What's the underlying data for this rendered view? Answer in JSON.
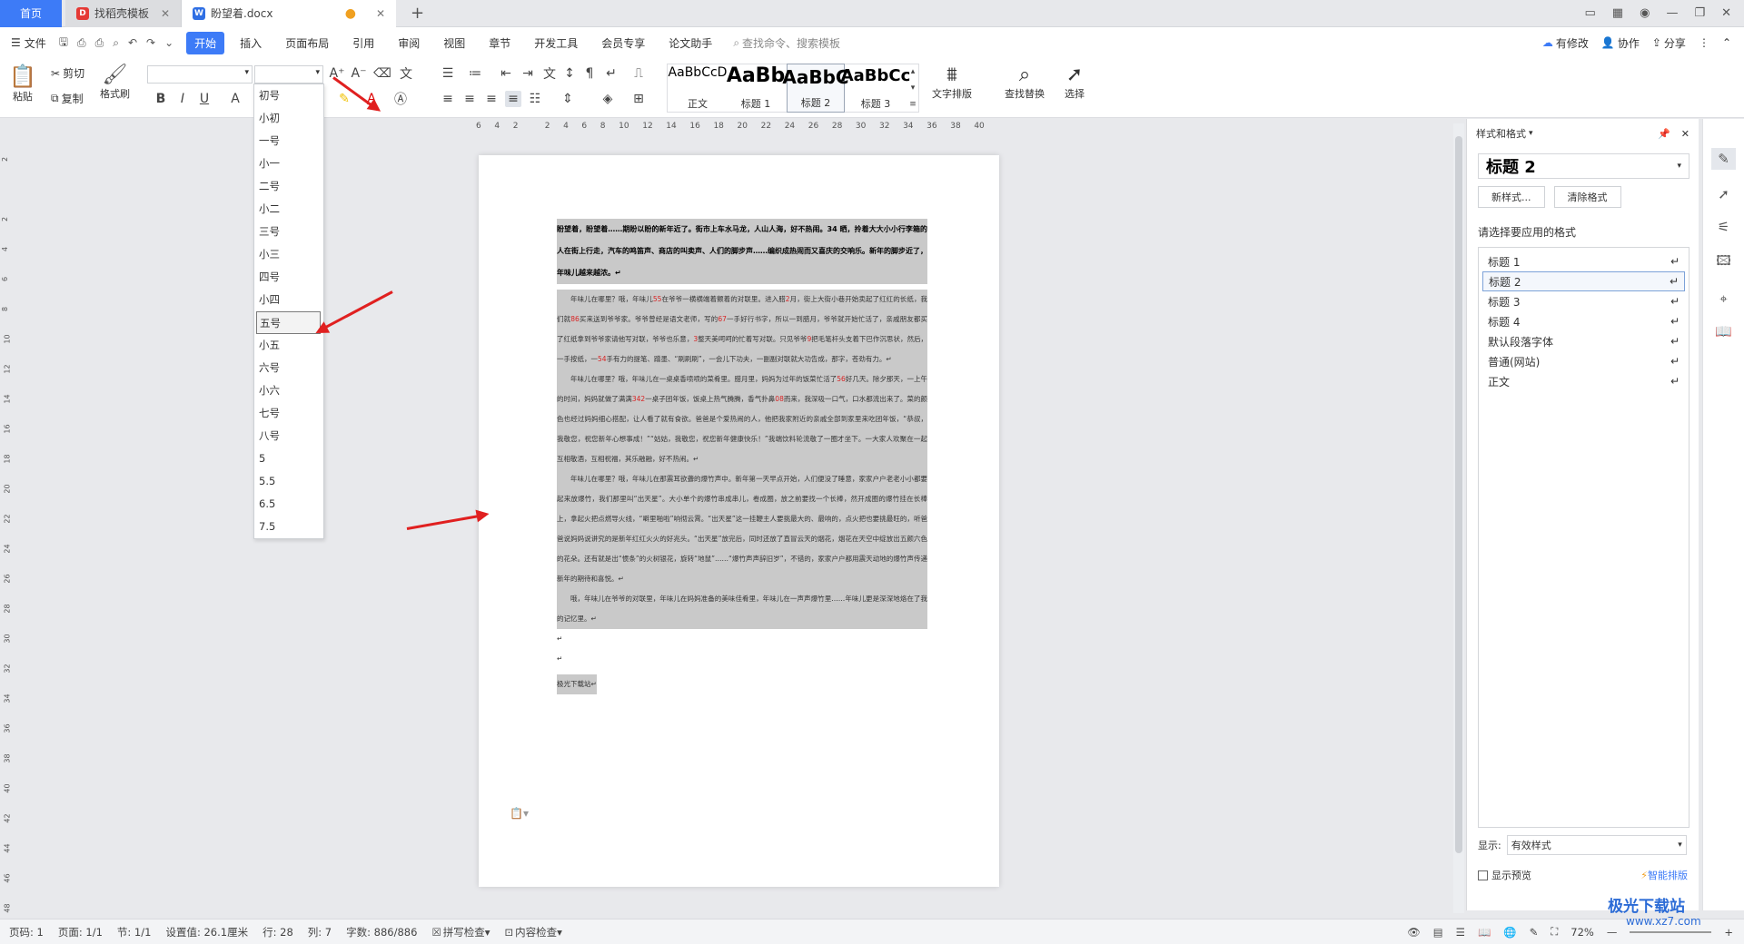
{
  "tabs": {
    "home": "首页",
    "template": "找稻壳模板",
    "doc": "盼望着.docx"
  },
  "menu": {
    "file": "文件",
    "items": [
      "开始",
      "插入",
      "页面布局",
      "引用",
      "审阅",
      "视图",
      "章节",
      "开发工具",
      "会员专享",
      "论文助手"
    ],
    "search": "查找命令、搜索模板",
    "right": [
      "有修改",
      "协作",
      "分享"
    ]
  },
  "ribbon": {
    "paste": "粘贴",
    "cut": "剪切",
    "copy": "复制",
    "format_painter": "格式刷",
    "styles": [
      {
        "preview": "AaBbCcD",
        "name": "正文"
      },
      {
        "preview": "AaBb",
        "name": "标题 1"
      },
      {
        "preview": "AaBbC",
        "name": "标题 2"
      },
      {
        "preview": "AaBbCc",
        "name": "标题 3"
      }
    ],
    "text_layout": "文字排版",
    "find_replace": "查找替换",
    "select": "选择"
  },
  "font_size_dropdown": {
    "options": [
      "初号",
      "小初",
      "一号",
      "小一",
      "二号",
      "小二",
      "三号",
      "小三",
      "四号",
      "小四",
      "五号",
      "小五",
      "六号",
      "小六",
      "七号",
      "八号",
      "5",
      "5.5",
      "6.5",
      "7.5"
    ],
    "selected": "五号"
  },
  "ruler_top": [
    "6",
    "4",
    "2",
    "",
    "2",
    "4",
    "6",
    "8",
    "10",
    "12",
    "14",
    "16",
    "18",
    "20",
    "22",
    "24",
    "26",
    "28",
    "30",
    "32",
    "34",
    "36",
    "38",
    "40"
  ],
  "ruler_left": [
    "2",
    "",
    "2",
    "4",
    "6",
    "8",
    "10",
    "12",
    "14",
    "16",
    "18",
    "20",
    "22",
    "24",
    "26",
    "28",
    "30",
    "32",
    "34",
    "36",
    "38",
    "40",
    "42",
    "44",
    "46",
    "48"
  ],
  "document": {
    "para1": "盼望着，盼望着……期盼以盼的新年近了。街市上车水马龙，人山人海，好不热闹。34 晒，拎着大大小小行李箱的人在街上行走，汽车的鸣笛声、商店的叫卖声、人们的脚步声……编织成热闹而又喜庆的交响乐。新年的脚步近了，年味儿越来越浓。↵",
    "para2_parts": [
      "年味儿在哪里？哦，年味儿",
      "55",
      "在爷爷一横横端着颤着的对联里。进入腊",
      "2",
      "月，街上大街小巷开始卖起了红红的长纸，我们就",
      "86",
      "买来送到爷爷家。爷爷曾经是语文老师，写的",
      "67",
      "一手好行书字，所以一到腊月，爷爷就开始忙活了，亲戚朋友都买了红纸拿到爷爷家请他写对联，爷爷也乐意，",
      "3",
      "整天美呵呵的忙着写对联。只见爷爷",
      "9",
      "把毛笔杆头支着下巴作沉思状，然后，一手按纸，一",
      "54",
      "手有力的提笔、蹭墨、“刷刷刷”，一会儿下功夫，一副副对联就大功告成，那字，苍劲有力。↵"
    ],
    "para3_parts": [
      "年味儿在哪里？哦，年味儿在一桌桌香喷喷的菜肴里。腊月里，妈妈为过年的饭菜忙活了",
      "56",
      "好几天。除夕那天，一上午的时间，妈妈就做了满满",
      "342",
      "一桌子团年饭，饭桌上热气腾腾，香气扑鼻",
      "08",
      "而来，我深吸一口气，口水都流出来了。菜的颜色也经过妈妈细心搭配，让人看了就有食欲。爸爸是个爱热闹的人，他把我家附近的亲戚全部到家里来吃团年饭，“恭叔，我敬您，祝您新年心想事成！”“姑姑，我敬您，祝您新年健康快乐！”我端饮料轮流敬了一圈才坐下。一大家人欢聚在一起互相敬酒，互相祝福，其乐融融，好不热闹。↵"
    ],
    "para4": "年味儿在哪里？哦，年味儿在那震耳欲聋的爆竹声中。新年第一天早点开始，人们便没了睡意，家家户户老老小小都要起来放爆竹，我们那里叫“出天星”。大小单个的爆竹串成串儿，卷成圈，放之前要找一个长棒，然开成圈的爆竹挂在长棒上，拿起火把点燃导火线，“噼里啪啦”响彻云霄。“出天星”这一挂鞭主人要挑最大的、最响的，点火把也要挑最旺的，听爸爸说妈妈说讲究的是新年红红火火的好兆头。“出天星”放完后，同时还放了直冒云天的烟花，烟花在天空中绽放出五颜六色的花朵。还有就是出“惯条”的火树银花，旋转“地鼠”……“爆竹声声辞旧岁”，不错的，家家户户都用震天动地的爆竹声传递新年的期待和喜悦。↵",
    "para5": "哦，年味儿在爷爷的对联里，年味儿在妈妈准备的美味佳肴里，年味儿在一声声爆竹里……年味儿更是深深地烙在了我的记忆里。↵",
    "footer_line": "极光下载站↵"
  },
  "styles_panel": {
    "title": "样式和格式",
    "current_style": "标题  2",
    "new_style": "新样式...",
    "clear_format": "清除格式",
    "prompt": "请选择要应用的格式",
    "styles": [
      "标题 1",
      "标题 2",
      "标题 3",
      "标题 4",
      "默认段落字体",
      "普通(网站)",
      "正文"
    ],
    "selected": "标题 2",
    "show_label": "显示:",
    "show_value": "有效样式",
    "preview_label": "显示预览",
    "smart_layout": "智能排版"
  },
  "status": {
    "page_num": "页码: 1",
    "pages": "页面: 1/1",
    "section": "节: 1/1",
    "setting": "设置值: 26.1厘米",
    "row": "行: 28",
    "col": "列: 7",
    "words": "字数: 886/886",
    "spell": "拼写检查",
    "content_check": "内容检查",
    "zoom": "72%"
  },
  "watermark": {
    "brand": "极光下载站",
    "url": "www.xz7.com"
  }
}
